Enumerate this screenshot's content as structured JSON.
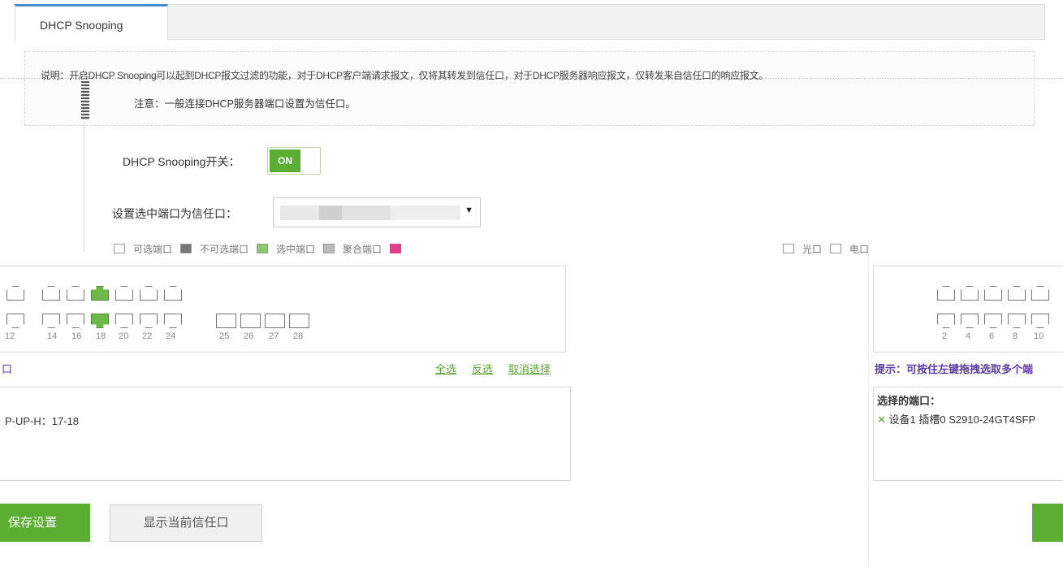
{
  "tabs": {
    "active": "DHCP Snooping"
  },
  "notes": {
    "line1": "说明：开启DHCP Snooping可以起到DHCP报文过滤的功能，对于DHCP客户端请求报文，仅将其转发到信任口，对于DHCP服务器响应报文，仅转发来自信任口的响应报文。",
    "line2": "注意：一般连接DHCP服务器端口设置为信任口。"
  },
  "switch": {
    "label": "DHCP Snooping开关：",
    "state": "ON"
  },
  "trust_select": {
    "label": "设置选中端口为信任口：",
    "value": ""
  },
  "legend": {
    "items": [
      "可选端口",
      "不可选端口",
      "选中端口",
      "聚合端口",
      "光口",
      "电口"
    ]
  },
  "ports": {
    "top_numbers": [],
    "bottom_numbers": [
      "12",
      "14",
      "16",
      "18",
      "20",
      "22",
      "24",
      "25",
      "26",
      "27",
      "28"
    ]
  },
  "actions": {
    "select_all": "全选",
    "invert": "反选",
    "cancel": "取消选择"
  },
  "left_panel": {
    "title_tail": "口",
    "entry": "P-UP-H：17-18"
  },
  "buttons": {
    "save": "保存设置",
    "show_trust": "显示当前信任口"
  },
  "right_panel": {
    "bottom_numbers": [
      "2",
      "4",
      "6",
      "8",
      "10"
    ],
    "hint": "提示：可按住左键拖拽选取多个端",
    "selected_title": "选择的端口：",
    "selected_entry": "设备1 插槽0 S2910-24GT4SFP",
    "remove_icon": "x-icon"
  },
  "colors": {
    "accent": "#5cae33",
    "tab_border": "#4a8bd6",
    "hint": "#5b3aa3"
  }
}
